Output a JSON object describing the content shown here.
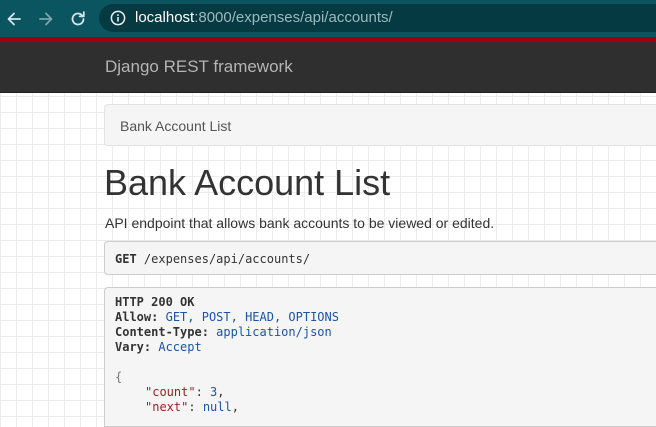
{
  "browser": {
    "url_host": "localhost",
    "url_rest": ":8000/expenses/api/accounts/"
  },
  "navbar": {
    "brand": "Django REST framework"
  },
  "breadcrumb": {
    "items": [
      "Bank Account List"
    ]
  },
  "page": {
    "title": "Bank Account List",
    "description": "API endpoint that allows bank accounts to be viewed or edited."
  },
  "request": {
    "method": "GET",
    "path": "/expenses/api/accounts/"
  },
  "response": {
    "status": "HTTP 200 OK",
    "headers": [
      {
        "key": "Allow:",
        "value": "GET, POST, HEAD, OPTIONS"
      },
      {
        "key": "Content-Type:",
        "value": "application/json"
      },
      {
        "key": "Vary:",
        "value": "Accept"
      }
    ],
    "body": {
      "open_brace": "{",
      "lines": [
        {
          "key": "\"count\"",
          "sep": ": ",
          "value": "3",
          "end": ","
        },
        {
          "key": "\"next\"",
          "sep": ": ",
          "value": "null",
          "end": ","
        }
      ]
    }
  },
  "icons": {
    "back": "arrow-left-icon",
    "forward": "arrow-right-icon",
    "reload": "reload-icon",
    "site_info": "info-icon"
  },
  "colors": {
    "navbar": "#2f2f2f",
    "navbar_strip": "#a30000",
    "browser_chrome": "#0b5560"
  }
}
